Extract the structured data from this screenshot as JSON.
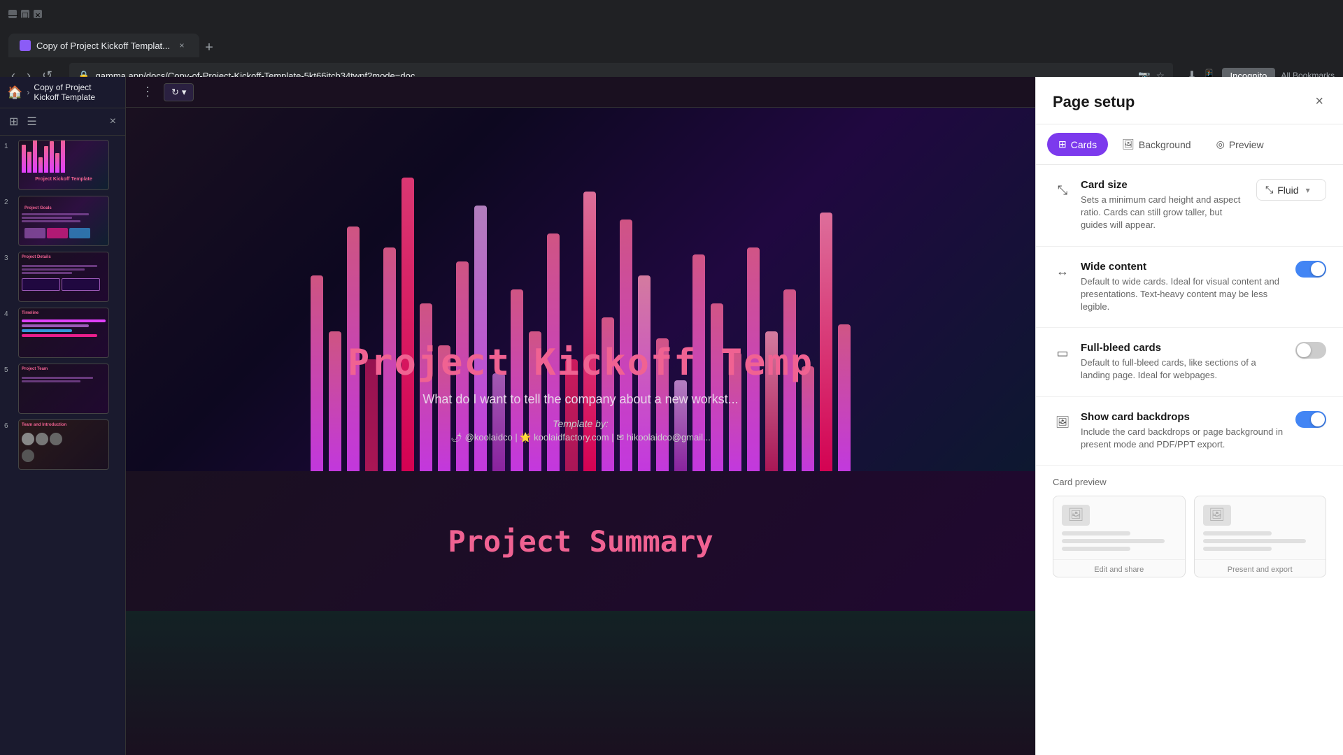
{
  "browser": {
    "tab_title": "Copy of Project Kickoff Templat...",
    "tab_close": "×",
    "tab_new": "+",
    "url": "gamma.app/docs/Copy-of-Project-Kickoff-Template-5kt66itcb34twpf?mode=doc",
    "nav_back": "‹",
    "nav_forward": "›",
    "nav_reload": "↺",
    "incognito_label": "Incognito",
    "bookmarks_label": "All Bookmarks",
    "window_minimize": "—",
    "window_maximize": "□",
    "window_close": "×"
  },
  "sidebar": {
    "breadcrumb_home": "🏠",
    "breadcrumb_sep": "›",
    "breadcrumb_title": "Copy of Project Kickoff Template",
    "view_grid_icon": "⊞",
    "view_list_icon": "☰",
    "close_icon": "×",
    "slides": [
      {
        "number": "1",
        "type": "hero"
      },
      {
        "number": "2",
        "type": "data"
      },
      {
        "number": "3",
        "type": "data2"
      },
      {
        "number": "4",
        "type": "data3"
      },
      {
        "number": "5",
        "type": "data4"
      },
      {
        "number": "6",
        "type": "people"
      }
    ]
  },
  "canvas": {
    "menu_icon": "⋮",
    "rotate_icon": "↻",
    "rotate_label": "↻"
  },
  "main_slide": {
    "title": "Project Kickoff Temp",
    "subtitle": "What do I want to tell the company about a new workst...",
    "template_by": "Template by:",
    "credits": "@koolaidco | 🌟 koolaidfactory.com | ✉ hikoolaidco@gmail...",
    "summary_title": "Project Summary"
  },
  "panel": {
    "title": "Page setup",
    "close_icon": "×",
    "tabs": [
      {
        "id": "cards",
        "label": "Cards",
        "icon": "⊞",
        "active": true
      },
      {
        "id": "background",
        "label": "Background",
        "icon": "🖼",
        "active": false
      },
      {
        "id": "preview",
        "label": "Preview",
        "icon": "◎",
        "active": false
      }
    ],
    "sections": [
      {
        "id": "card-size",
        "icon": "⤡",
        "label": "Card size",
        "desc": "Sets a minimum card height and aspect ratio. Cards can still grow taller, but guides will appear.",
        "control_type": "dropdown",
        "control_value": "Fluid",
        "control_icon": "⤡"
      },
      {
        "id": "wide-content",
        "icon": "↔",
        "label": "Wide content",
        "desc": "Default to wide cards. Ideal for visual content and presentations. Text-heavy content may be less legible.",
        "control_type": "toggle",
        "control_value": true
      },
      {
        "id": "full-bleed",
        "icon": "▭",
        "label": "Full-bleed cards",
        "desc": "Default to full-bleed cards, like sections of a landing page. Ideal for webpages.",
        "control_type": "toggle",
        "control_value": false
      },
      {
        "id": "show-backdrops",
        "icon": "🖼",
        "label": "Show card backdrops",
        "desc": "Include the card backdrops or page background in present mode and PDF/PPT export.",
        "control_type": "toggle",
        "control_value": true
      }
    ],
    "card_preview": {
      "label": "Card preview",
      "cards": [
        {
          "id": "edit-share",
          "label": "Edit and share"
        },
        {
          "id": "present-export",
          "label": "Present and export"
        }
      ]
    }
  }
}
